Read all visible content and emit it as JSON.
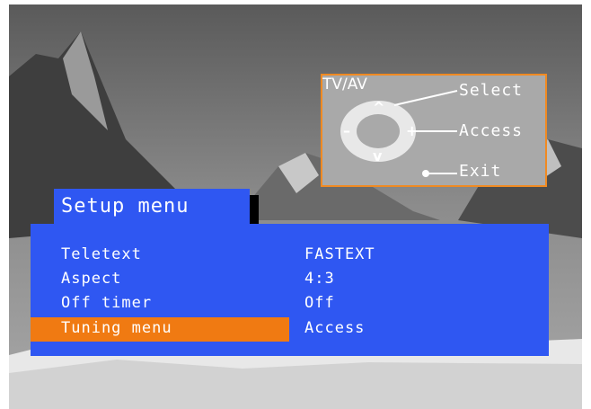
{
  "help_box": {
    "select_label": "Select",
    "access_label": "Access",
    "exit_label": "Exit",
    "tvav_label": "TV/AV",
    "up_glyph": "^",
    "down_glyph": "v",
    "plus_glyph": "+",
    "minus_glyph": "–",
    "border_color": "#f08a22"
  },
  "menu": {
    "title": "Setup menu",
    "panel_color": "#2f57f2",
    "highlight_color": "#f07a12",
    "rows": [
      {
        "label": "Teletext",
        "value": "FASTEXT"
      },
      {
        "label": "Aspect",
        "value": "4:3"
      },
      {
        "label": "Off timer",
        "value": "Off"
      },
      {
        "label": "Tuning menu",
        "value": "Access"
      }
    ]
  }
}
